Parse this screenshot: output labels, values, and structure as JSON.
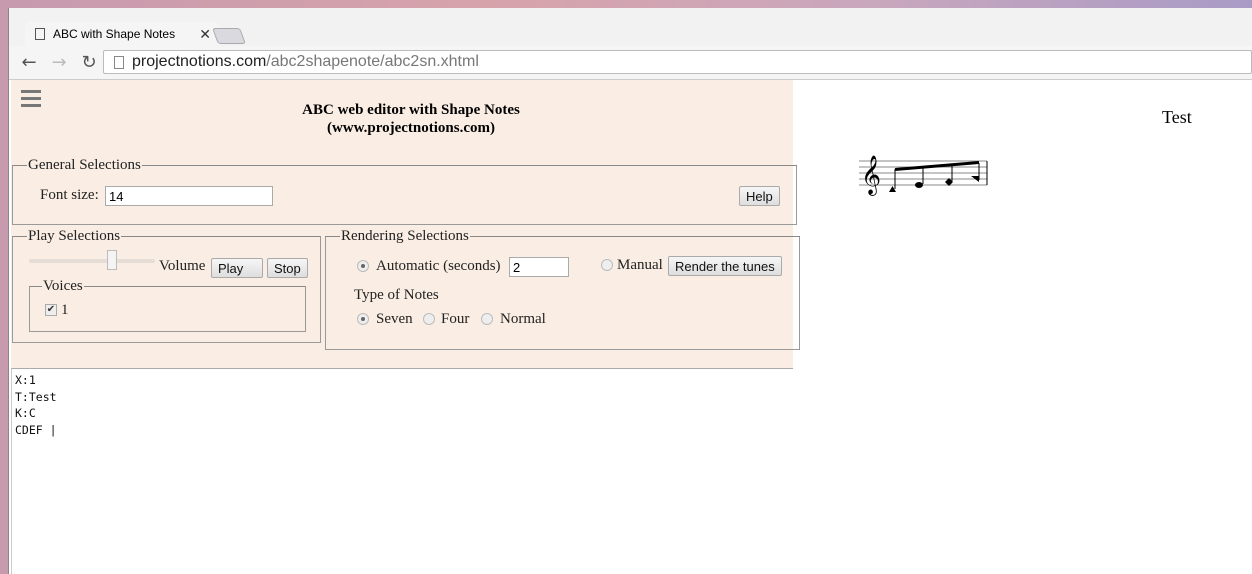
{
  "browser": {
    "tab_title": "ABC with Shape Notes",
    "url_host": "projectnotions.com",
    "url_path": "/abc2shapenote/abc2sn.xhtml"
  },
  "header": {
    "title_line1": "ABC web editor with Shape Notes",
    "title_line2": "(www.projectnotions.com)"
  },
  "general": {
    "legend": "General Selections",
    "font_size_label": "Font size:",
    "font_size_value": "14",
    "help_label": "Help"
  },
  "play": {
    "legend": "Play Selections",
    "volume_label": "Volume",
    "volume_level": 0.65,
    "play_label": "Play",
    "stop_label": "Stop",
    "voices_legend": "Voices",
    "voices": [
      {
        "label": "1",
        "checked": true
      }
    ]
  },
  "rendering": {
    "legend": "Rendering Selections",
    "automatic_label": "Automatic (seconds)",
    "automatic_value": "2",
    "automatic_selected": true,
    "manual_label": "Manual",
    "render_label": "Render the tunes",
    "type_label": "Type of Notes",
    "note_types": [
      {
        "label": "Seven",
        "selected": true
      },
      {
        "label": "Four",
        "selected": false
      },
      {
        "label": "Normal",
        "selected": false
      }
    ]
  },
  "editor": {
    "text": "X:1\nT:Test\nK:C\nCDEF |"
  },
  "preview": {
    "tune_title": "Test"
  }
}
